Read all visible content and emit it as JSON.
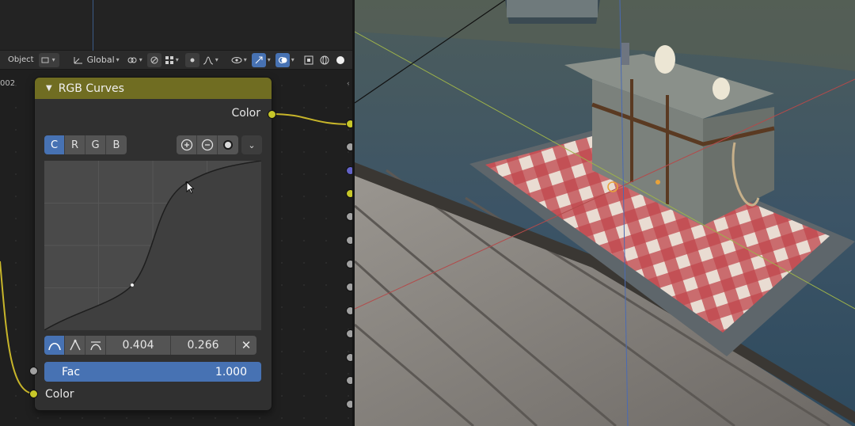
{
  "header": {
    "object_label": "Object",
    "orientation_label": "Global"
  },
  "edge_label": "002",
  "node": {
    "title": "RGB Curves",
    "output_label": "Color",
    "channels": [
      "C",
      "R",
      "G",
      "B"
    ],
    "active_channel": "C",
    "point_x": "0.404",
    "point_y": "0.266",
    "fac_label": "Fac",
    "fac_value": "1.000",
    "input_label": "Color"
  },
  "colors": {
    "node_header": "#706d22",
    "accent": "#4772b3",
    "socket_color": "#c7c729",
    "wire": "#c7b52a"
  }
}
